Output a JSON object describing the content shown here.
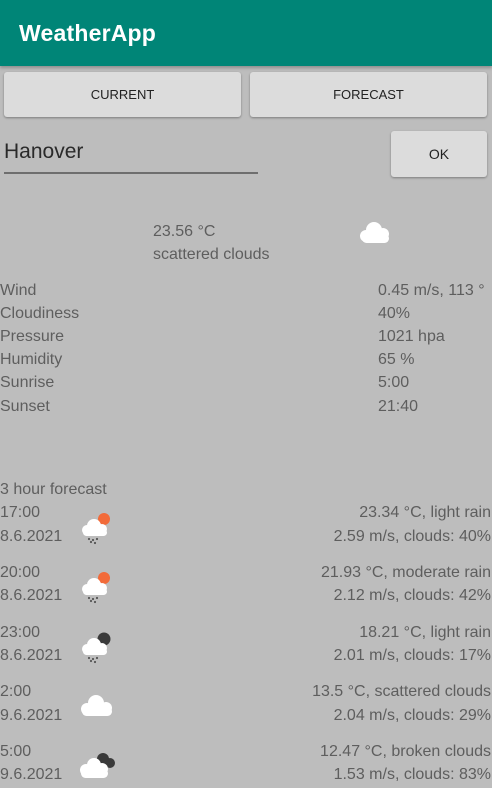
{
  "app": {
    "title": "WeatherApp"
  },
  "tabs": {
    "current": "CURRENT",
    "forecast": "FORECAST"
  },
  "search": {
    "city_value": "Hanover",
    "ok_label": "OK"
  },
  "current": {
    "temperature": "23.56 °C",
    "description": "scattered clouds",
    "icon": "cloud-icon",
    "details": [
      {
        "label": "Wind",
        "value": "0.45 m/s, 113 °"
      },
      {
        "label": "Cloudiness",
        "value": "40%"
      },
      {
        "label": "Pressure",
        "value": "1021 hpa"
      },
      {
        "label": "Humidity",
        "value": "65 %"
      },
      {
        "label": "Sunrise",
        "value": "5:00"
      },
      {
        "label": "Sunset",
        "value": "21:40"
      }
    ]
  },
  "forecast": {
    "title": "3 hour forecast",
    "items": [
      {
        "time": "17:00",
        "date": "8.6.2021",
        "line1": "23.34 °C, light rain",
        "line2": "2.59 m/s, clouds: 40%",
        "icon": "sun-rain-cloud-icon"
      },
      {
        "time": "20:00",
        "date": "8.6.2021",
        "line1": "21.93 °C, moderate rain",
        "line2": "2.12 m/s, clouds: 42%",
        "icon": "sun-rain-cloud-icon"
      },
      {
        "time": "23:00",
        "date": "8.6.2021",
        "line1": "18.21 °C, light rain",
        "line2": "2.01 m/s, clouds: 17%",
        "icon": "dark-rain-cloud-icon"
      },
      {
        "time": "2:00",
        "date": "9.6.2021",
        "line1": "13.5 °C, scattered clouds",
        "line2": "2.04 m/s, clouds: 29%",
        "icon": "cloud-icon"
      },
      {
        "time": "5:00",
        "date": "9.6.2021",
        "line1": "12.47 °C, broken clouds",
        "line2": "1.53 m/s, clouds: 83%",
        "icon": "broken-clouds-icon"
      }
    ]
  },
  "colors": {
    "appbar": "#008577",
    "background": "#bdbdbd",
    "button": "#dcdcdc",
    "sun": "#f26b3a"
  }
}
